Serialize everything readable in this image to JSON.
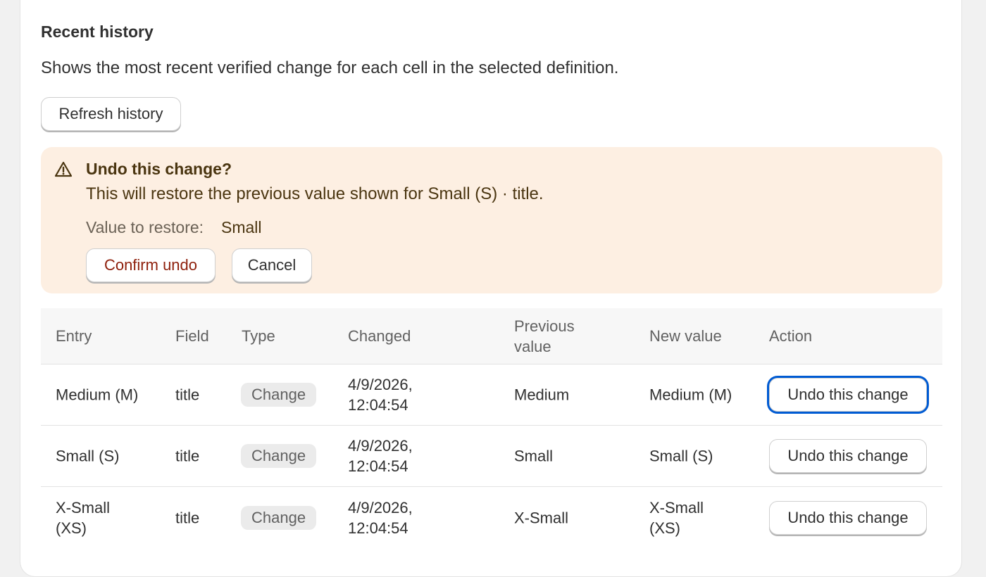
{
  "section": {
    "title": "Recent history",
    "description": "Shows the most recent verified change for each cell in the selected definition.",
    "refresh_label": "Refresh history"
  },
  "banner": {
    "icon": "warning-triangle-icon",
    "title": "Undo this change?",
    "message": "This will restore the previous value shown for Small (S) · title.",
    "restore_label": "Value to restore:",
    "restore_value": "Small",
    "confirm_label": "Confirm undo",
    "cancel_label": "Cancel",
    "colors": {
      "background": "#fdefe2",
      "confirm_text": "#8e1f0b"
    }
  },
  "table": {
    "headers": {
      "entry": "Entry",
      "field": "Field",
      "type": "Type",
      "changed": "Changed",
      "previous_value": "Previous value",
      "new_value": "New value",
      "action": "Action"
    },
    "rows": [
      {
        "entry": "Medium (M)",
        "field": "title",
        "type": "Change",
        "changed": "4/9/2026, 12:04:54",
        "previous_value": "Medium",
        "new_value": "Medium (M)",
        "action": "Undo this change"
      },
      {
        "entry": "Small (S)",
        "field": "title",
        "type": "Change",
        "changed": "4/9/2026, 12:04:54",
        "previous_value": "Small",
        "new_value": "Small (S)",
        "action": "Undo this change"
      },
      {
        "entry": "X-Small (XS)",
        "field": "title",
        "type": "Change",
        "changed": "4/9/2026, 12:04:54",
        "previous_value": "X-Small",
        "new_value": "X-Small (XS)",
        "action": "Undo this change"
      }
    ]
  }
}
